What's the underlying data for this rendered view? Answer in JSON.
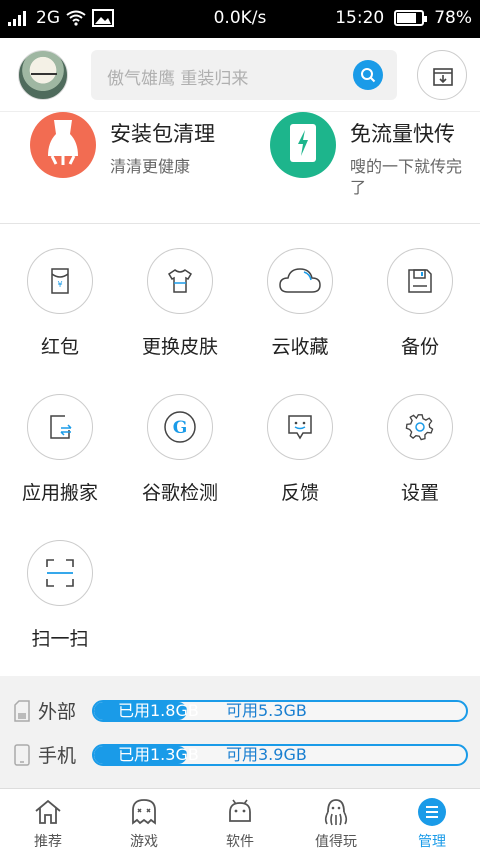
{
  "statusbar": {
    "network": "2G",
    "speed": "0.0K/s",
    "time": "15:20",
    "battery": "78%",
    "battery_level": 0.78
  },
  "header": {
    "search_placeholder": "傲气雄鹰 重装归来",
    "icons": [
      "avatar",
      "search-icon",
      "download-manager-icon"
    ]
  },
  "cards": [
    {
      "title": "安装包清理",
      "subtitle": "清清更健康",
      "color": "#f26c52",
      "icon": "broom-icon"
    },
    {
      "title": "免流量快传",
      "subtitle": "嗖的一下就传完了",
      "color": "#1db58c",
      "icon": "phone-flash-icon"
    }
  ],
  "tools": [
    {
      "label": "红包",
      "icon": "red-envelope-icon"
    },
    {
      "label": "更换皮肤",
      "icon": "tshirt-icon"
    },
    {
      "label": "云收藏",
      "icon": "cloud-icon"
    },
    {
      "label": "备份",
      "icon": "floppy-icon"
    },
    {
      "label": "应用搬家",
      "icon": "app-move-icon"
    },
    {
      "label": "谷歌检测",
      "icon": "google-icon"
    },
    {
      "label": "反馈",
      "icon": "feedback-icon"
    },
    {
      "label": "设置",
      "icon": "gear-icon"
    },
    {
      "label": "扫一扫",
      "icon": "scan-icon"
    }
  ],
  "storage": [
    {
      "name": "外部",
      "used": "已用1.8GB",
      "free": "可用5.3GB",
      "used_fraction": 0.25
    },
    {
      "name": "手机",
      "used": "已用1.3GB",
      "free": "可用3.9GB",
      "used_fraction": 0.25
    }
  ],
  "nav": [
    {
      "label": "推荐",
      "icon": "home-icon",
      "active": false
    },
    {
      "label": "游戏",
      "icon": "ghost-icon",
      "active": false
    },
    {
      "label": "软件",
      "icon": "android-icon",
      "active": false
    },
    {
      "label": "值得玩",
      "icon": "octopus-icon",
      "active": false
    },
    {
      "label": "管理",
      "icon": "manage-icon",
      "active": true
    }
  ],
  "colors": {
    "accent": "#1a9be8",
    "orange": "#f26c52",
    "green": "#1db58c"
  }
}
